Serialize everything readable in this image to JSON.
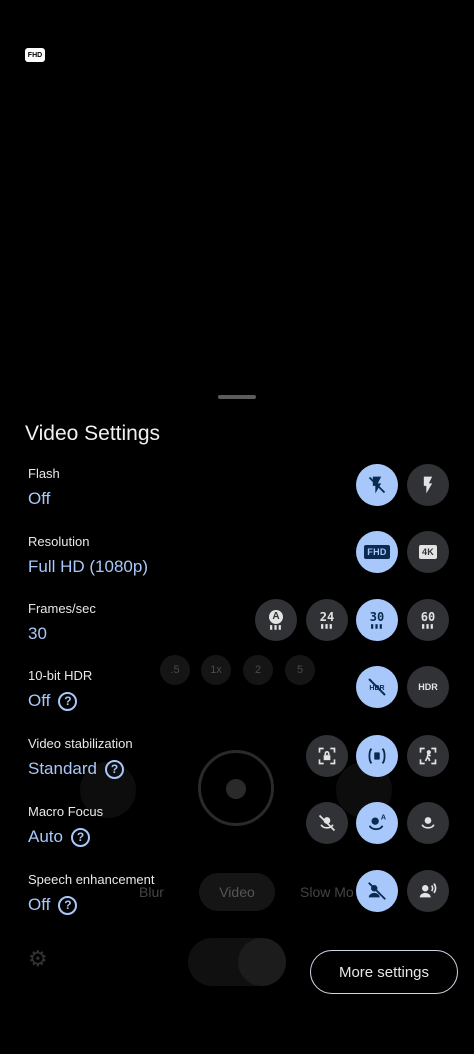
{
  "viewfinder": {
    "resolution_badge": "FHD"
  },
  "background": {
    "zoom_levels": [
      ".5",
      "1x",
      "2",
      "5"
    ],
    "modes": [
      "Blur",
      "Video",
      "Slow Mo"
    ]
  },
  "sheet": {
    "title": "Video Settings",
    "more_settings": "More settings",
    "rows": {
      "flash": {
        "label": "Flash",
        "value": "Off"
      },
      "resolution": {
        "label": "Resolution",
        "value": "Full HD (1080p)"
      },
      "fps": {
        "label": "Frames/sec",
        "value": "30"
      },
      "hdr": {
        "label": "10-bit HDR",
        "value": "Off"
      },
      "stabilization": {
        "label": "Video stabilization",
        "value": "Standard"
      },
      "macro": {
        "label": "Macro Focus",
        "value": "Auto"
      },
      "speech": {
        "label": "Speech enhancement",
        "value": "Off"
      }
    },
    "option_badges": {
      "fhd": "FHD",
      "4k": "4K",
      "auto": "A",
      "fps24": "24",
      "fps30": "30",
      "fps60": "60",
      "hdr": "HDR"
    }
  },
  "colors": {
    "accent": "#a8c7fa",
    "option_bg": "#303235",
    "background": "#000000"
  }
}
